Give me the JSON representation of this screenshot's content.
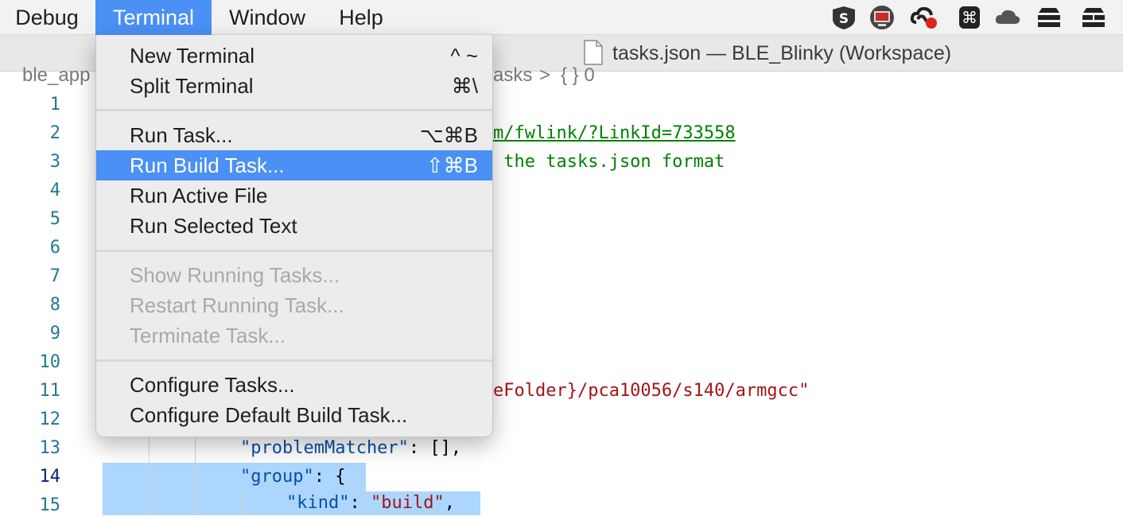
{
  "menubar": {
    "items": [
      {
        "label": "Debug"
      },
      {
        "label": "Terminal"
      },
      {
        "label": "Window"
      },
      {
        "label": "Help"
      }
    ],
    "status_icons": [
      "shield-s-icon",
      "screen-record-icon",
      "creative-cloud-icon",
      "command-key-icon",
      "cloud-icon",
      "stack-icon",
      "stack-alt-icon"
    ]
  },
  "window": {
    "title": "tasks.json — BLE_Blinky (Workspace)"
  },
  "breadcrumb": {
    "left": "ble_app",
    "middle": "asks",
    "separator": ">",
    "right": "{ } 0"
  },
  "editor": {
    "line_numbers": [
      "1",
      "2",
      "3",
      "4",
      "5",
      "6",
      "7",
      "8",
      "9",
      "10",
      "11",
      "12",
      "13",
      "14",
      "15"
    ],
    "current_line": "14",
    "lines": {
      "l2": "m/fwlink/?LinkId=733558",
      "l3": " the tasks.json format",
      "l11": "eFolder}/pca10056/s140/armgcc\"",
      "l13_key": "\"problemMatcher\"",
      "l13_rest": ": [],",
      "l14_key": "\"group\"",
      "l14_rest": ": {",
      "l15_key": "\"kind\"",
      "l15_mid": ": ",
      "l15_val": "\"build\"",
      "l15_end": ","
    }
  },
  "terminal_menu": {
    "items": [
      {
        "label": "New Terminal",
        "shortcut": "^ ~"
      },
      {
        "label": "Split Terminal",
        "shortcut": "⌘\\"
      },
      {
        "label": "Run Task...",
        "shortcut": "⌥⌘B"
      },
      {
        "label": "Run Build Task...",
        "shortcut": "⇧⌘B"
      },
      {
        "label": "Run Active File",
        "shortcut": ""
      },
      {
        "label": "Run Selected Text",
        "shortcut": ""
      },
      {
        "label": "Show Running Tasks...",
        "shortcut": ""
      },
      {
        "label": "Restart Running Task...",
        "shortcut": ""
      },
      {
        "label": "Terminate Task...",
        "shortcut": ""
      },
      {
        "label": "Configure Tasks...",
        "shortcut": ""
      },
      {
        "label": "Configure Default Build Task...",
        "shortcut": ""
      }
    ]
  },
  "colors": {
    "menu_highlight": "#4a90f5",
    "selection": "#add6ff",
    "comment": "#008000",
    "string": "#a31515",
    "key": "#0451a5",
    "line_number": "#237893"
  }
}
